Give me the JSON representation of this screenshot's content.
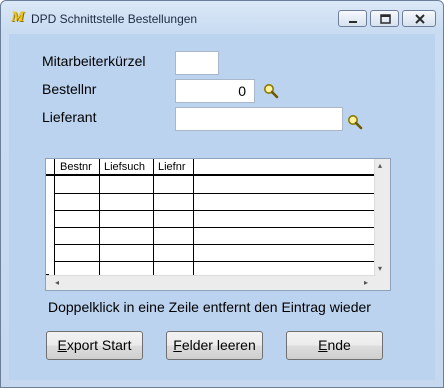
{
  "window": {
    "title": "DPD Schnittstelle Bestellungen",
    "app_icon_letter": "M",
    "accent_color": "#f1c40f"
  },
  "form": {
    "mitarbeiter": {
      "label": "Mitarbeiterkürzel",
      "value": ""
    },
    "bestellnr": {
      "label": "Bestellnr",
      "value": "0",
      "search_icon": "magnifier-icon"
    },
    "lieferant": {
      "label": "Lieferant",
      "value": "",
      "search_icon": "magnifier-icon"
    }
  },
  "grid": {
    "columns": [
      "Bestnr",
      "Liefsuch",
      "Liefnr"
    ],
    "rows": [
      [
        "",
        "",
        ""
      ],
      [
        "",
        "",
        ""
      ],
      [
        "",
        "",
        ""
      ],
      [
        "",
        "",
        ""
      ],
      [
        "",
        "",
        ""
      ],
      [
        "",
        "",
        ""
      ]
    ],
    "scroll_left_glyph": "◂",
    "scroll_right_glyph": "▸",
    "scroll_up_glyph": "▴",
    "scroll_down_glyph": "▾"
  },
  "hint": "Doppelklick in eine Zeile entfernt den Eintrag wieder",
  "buttons": {
    "export": {
      "first": "E",
      "rest": "xport Start"
    },
    "clear": {
      "first": "F",
      "rest": "elder leeren"
    },
    "end": {
      "first": "E",
      "rest": "nde"
    }
  }
}
